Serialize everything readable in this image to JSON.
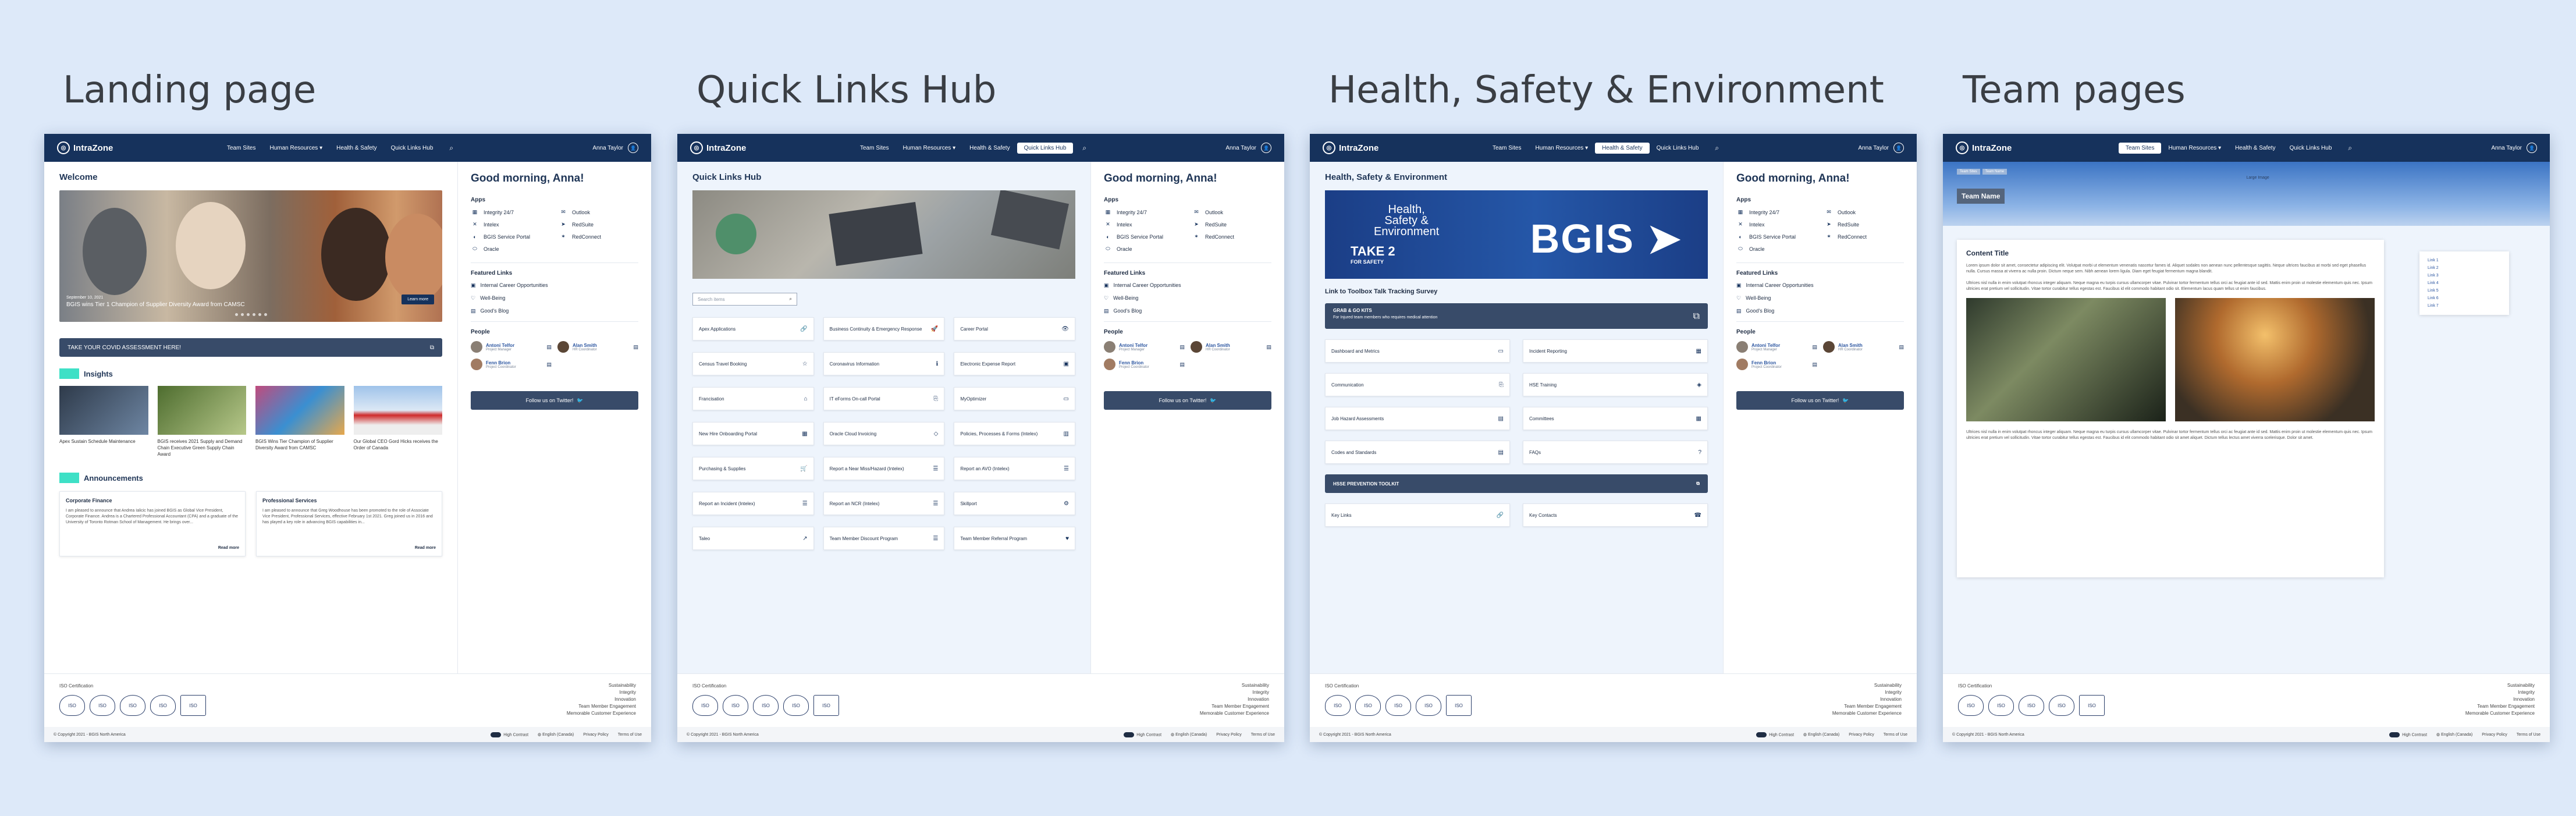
{
  "panels": [
    {
      "title": "Landing page"
    },
    {
      "title": "Quick Links Hub"
    },
    {
      "title": "Health, Safety & Environment"
    },
    {
      "title": "Team pages"
    }
  ],
  "header": {
    "logo": "IntraZone",
    "nav": [
      "Team Sites",
      "Human Resources",
      "Health & Safety",
      "Quick Links Hub"
    ],
    "user": "Anna Taylor"
  },
  "side": {
    "greeting": "Good morning, Anna!",
    "apps_heading": "Apps",
    "apps": [
      "Integrity 24/7",
      "Outlook",
      "Intelex",
      "RedSuite",
      "BGIS Service Portal",
      "RedConnect",
      "Oracle"
    ],
    "featured_heading": "Featured Links",
    "featured": [
      "Internal Career Opportunities",
      "Well-Being",
      "Good's Blog"
    ],
    "people_heading": "People",
    "people": [
      {
        "name": "Antoni Telfor",
        "role": "Project Manager"
      },
      {
        "name": "Alan Smith",
        "role": "HR Coordinator"
      },
      {
        "name": "Fenn Brion",
        "role": "Project Coordinator"
      }
    ],
    "twitter": "Follow us on Twitter!"
  },
  "footer": {
    "iso": "ISO Certification",
    "badges": [
      "ISO",
      "ISO",
      "ISO",
      "ISO",
      "ISO"
    ],
    "links": [
      "Sustainability",
      "Integrity",
      "Innovation",
      "Team Member Engagement",
      "Memorable Customer Experience"
    ],
    "copyright": "© Copyright 2021 - BGIS North America",
    "contrast": "High Contrast",
    "lang": "English (Canada)",
    "privacy": "Privacy Policy",
    "terms": "Terms of Use"
  },
  "landing": {
    "welcome": "Welcome",
    "hero_date": "September 10, 2021",
    "hero_caption": "BGIS wins Tier 1 Champion of Supplier Diversity Award from CAMSC",
    "hero_btn": "Learn more",
    "covid": "TAKE YOUR COVID ASSESSMENT HERE!",
    "insights": "Insights",
    "insight_cards": [
      "Apex Sustain Schedule Maintenance",
      "BGIS receives 2021 Supply and Demand Chain Executive Green Supply Chain Award",
      "BGIS Wins Tier Champion of Supplier Diversity Award from CAMSC",
      "Our Global CEO Gord Hicks receives the Order of Canada"
    ],
    "announcements": "Announcements",
    "ann": [
      {
        "title": "Corporate Finance",
        "body": "I am pleased to announce that Andrea Ialicic has joined BGIS as Global Vice President, Corporate Finance. Andrea is a Chartered Professional Accountant (CPA) and a graduate of the University of Toronto Rotman School of Management. He brings over...",
        "more": "Read more"
      },
      {
        "title": "Professional Services",
        "body": "I am pleased to announce that Greg Woodhouse has been promoted to the role of Associate Vice President, Professional Services, effective February 1st 2021. Greg joined us in 2016 and has played a key role in advancing BGIS capabilities in...",
        "more": "Read more"
      }
    ]
  },
  "quick": {
    "title": "Quick Links Hub",
    "search": "Search items",
    "tiles": [
      "Apex Applications",
      "Business Continuity & Emergency Response",
      "Career Portal",
      "Census Travel Booking",
      "Coronavirus Information",
      "Electronic Expense Report",
      "Francisation",
      "IT eForms On-call Portal",
      "MyOptimizer",
      "New Hire Onboarding Portal",
      "Oracle Cloud Invoicing",
      "Policies, Processes & Forms (Intelex)",
      "Purchasing & Supplies",
      "Report a Near Miss/Hazard (Intelex)",
      "Report an AVO (Intelex)",
      "Report an Incident (Intelex)",
      "Report an NCR (Intelex)",
      "Skillport",
      "Taleo",
      "Team Member Discount Program",
      "Team Member Referral Program"
    ],
    "icons": [
      "🔗",
      "🚀",
      "👁",
      "☆",
      "ℹ",
      "▣",
      "⌂",
      "⎘",
      "▭",
      "▦",
      "◇",
      "▥",
      "🛒",
      "☰",
      "☰",
      "☰",
      "☰",
      "⚙",
      "↗",
      "☰",
      "♥"
    ]
  },
  "hse": {
    "title": "Health, Safety & Environment",
    "banner_l1": "Health,\nSafety &\nEnvironment",
    "banner_l2": "TAKE 2",
    "banner_l3": "FOR SAFETY",
    "banner_brand": "BGIS",
    "survey": "Link to Toolbox Talk Tracking Survey",
    "grab_title": "GRAB & GO KITS",
    "grab_sub": "For Injured team members who requires medical attention",
    "tiles": [
      "Dashboard and Metrics",
      "Incident Reporting",
      "Communication",
      "HSE Training",
      "Job Hazard Assessments",
      "Committees",
      "Codes and Standards",
      "FAQs"
    ],
    "toolkit": "HSSE PREVENTION TOOLKIT",
    "tiles_b": [
      "Key Links",
      "Key Contacts"
    ]
  },
  "team": {
    "crumbs": [
      "Team Sites",
      "Team Name"
    ],
    "hero_label": "Large Image",
    "name": "Team Name",
    "content_title": "Content Title",
    "p1": "Lorem ipsum dolor sit amet, consectetur adipiscing elit. Volutpat morbi ut elementum venenatis nascetur fames id. Aliquet sodales non aenean nunc pellentesque sagittis. Neque ultrices faucibus at morbi sed eget phasellus nulla. Cursus massa at viverra ac nulla proin. Dictum neque sem. Nibh aenean lorem ligula. Diam eget feugiat fermentum magna blandit.",
    "p2": "Ultrices nisl nulla in enim volutpat rhoncus integer aliquam. Neque magna eu turpis cursus ullamcorper vitae. Pulvinar tortor fermentum tellus orci ac feugiat ante id sed. Mattis enim proin ut molestie elementum quis nec. Ipsum ultricies erat pretium vel sollicitudin. Vitae tortor curabitur tellus egestas est. Faucibus id elit commodo habitant odio sit. Elementum lacus quam tellus ut enim faucibus.",
    "p3": "Ultrices nisl nulla in enim volutpat rhoncus integer aliquam. Neque magna eu turpis cursus ullamcorper vitae. Pulvinar tortor fermentum tellus orci ac feugiat ante id sed. Mattis enim proin ut molestie elementum quis nec. Ipsum ultricies erat pretium vel sollicitudin. Vitae tortor curabitur tellus egestas est. Faucibus id elit commodo habitant odio sit amet aliquet. Dictum tellus lectus amet viverra scelerisque. Dolor sit amet.",
    "links": [
      "Link 1",
      "Link 2",
      "Link 3",
      "Link 4",
      "Link 5",
      "Link 6",
      "Link 7"
    ]
  },
  "colors": {
    "navy": "#16325c",
    "slate": "#384b69",
    "accent": "#3ee0c6",
    "page_bg": "#dde9f9"
  }
}
